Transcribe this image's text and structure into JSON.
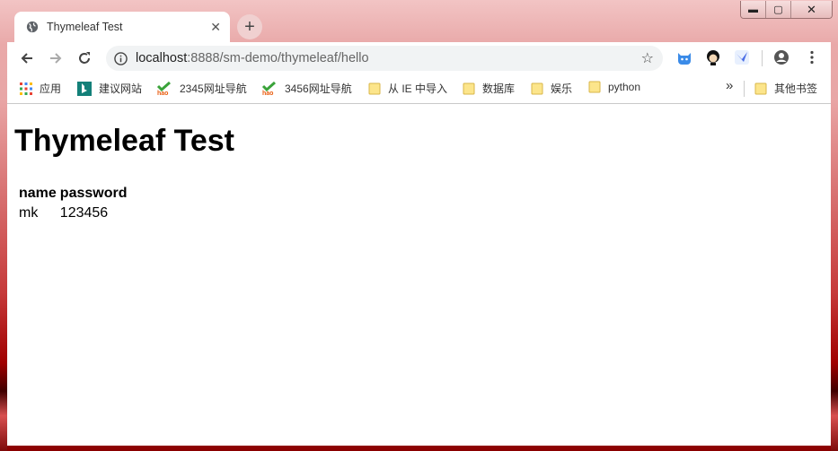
{
  "browser": {
    "tab_title": "Thymeleaf Test",
    "tab_close": "✕",
    "new_tab": "+",
    "url_host": "localhost",
    "url_path": ":8888/sm-demo/thymeleaf/hello",
    "window_controls": {
      "minimize": "▬",
      "maximize": "▢",
      "close": "✕"
    }
  },
  "bookmarks": [
    {
      "label": "应用",
      "icon": "apps-grid-icon"
    },
    {
      "label": "建议网站",
      "icon": "bing-icon"
    },
    {
      "label": "2345网址导航",
      "icon": "hao-icon"
    },
    {
      "label": "3456网址导航",
      "icon": "hao-icon"
    },
    {
      "label": "从 IE 中导入",
      "icon": "folder-icon"
    },
    {
      "label": "数据库",
      "icon": "folder-icon"
    },
    {
      "label": "娱乐",
      "icon": "folder-icon"
    },
    {
      "label": "python",
      "icon": "folder-icon"
    }
  ],
  "bookmarks_overflow": "»",
  "other_bookmarks": "其他书签",
  "page": {
    "title": "Thymeleaf Test",
    "table": {
      "headers": [
        "name",
        "password"
      ],
      "rows": [
        [
          "mk",
          "123456"
        ]
      ]
    }
  }
}
